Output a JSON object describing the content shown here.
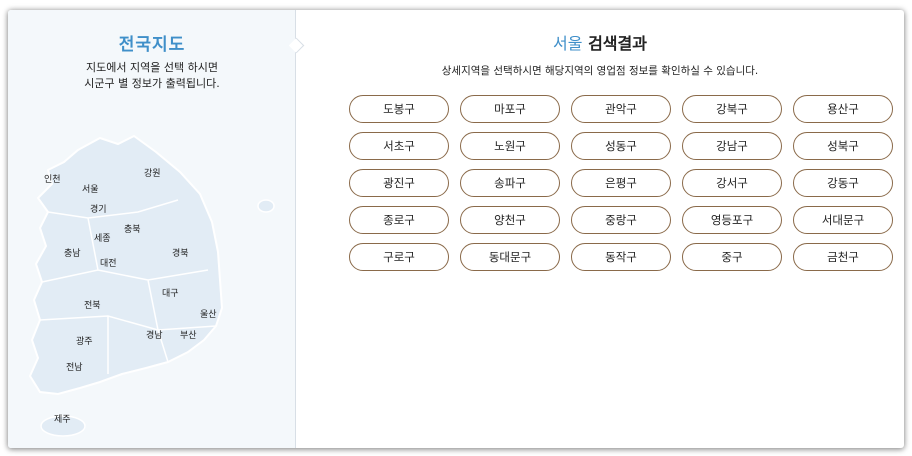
{
  "left_panel": {
    "title": "전국지도",
    "desc_line1": "지도에서 지역을 선택 하시면",
    "desc_line2": "시군구 별 정보가 출력됩니다.",
    "regions": [
      "인천",
      "서울",
      "강원",
      "경기",
      "충북",
      "세종",
      "충남",
      "대전",
      "경북",
      "대구",
      "전북",
      "울산",
      "광주",
      "경남",
      "부산",
      "전남",
      "제주"
    ]
  },
  "right_panel": {
    "city": "서울",
    "title_suffix": "검색결과",
    "desc": "상세지역을 선택하시면 해당지역의 영업점 정보를 확인하실 수 있습니다.",
    "districts": [
      "도봉구",
      "마포구",
      "관악구",
      "강북구",
      "용산구",
      "서초구",
      "노원구",
      "성동구",
      "강남구",
      "성북구",
      "광진구",
      "송파구",
      "은평구",
      "강서구",
      "강동구",
      "종로구",
      "양천구",
      "중랑구",
      "영등포구",
      "서대문구",
      "구로구",
      "동대문구",
      "동작구",
      "중구",
      "금천구"
    ]
  },
  "colors": {
    "accent": "#3f8fc9",
    "map_fill": "#e2ecf5",
    "button_border": "#8a6a4a"
  }
}
